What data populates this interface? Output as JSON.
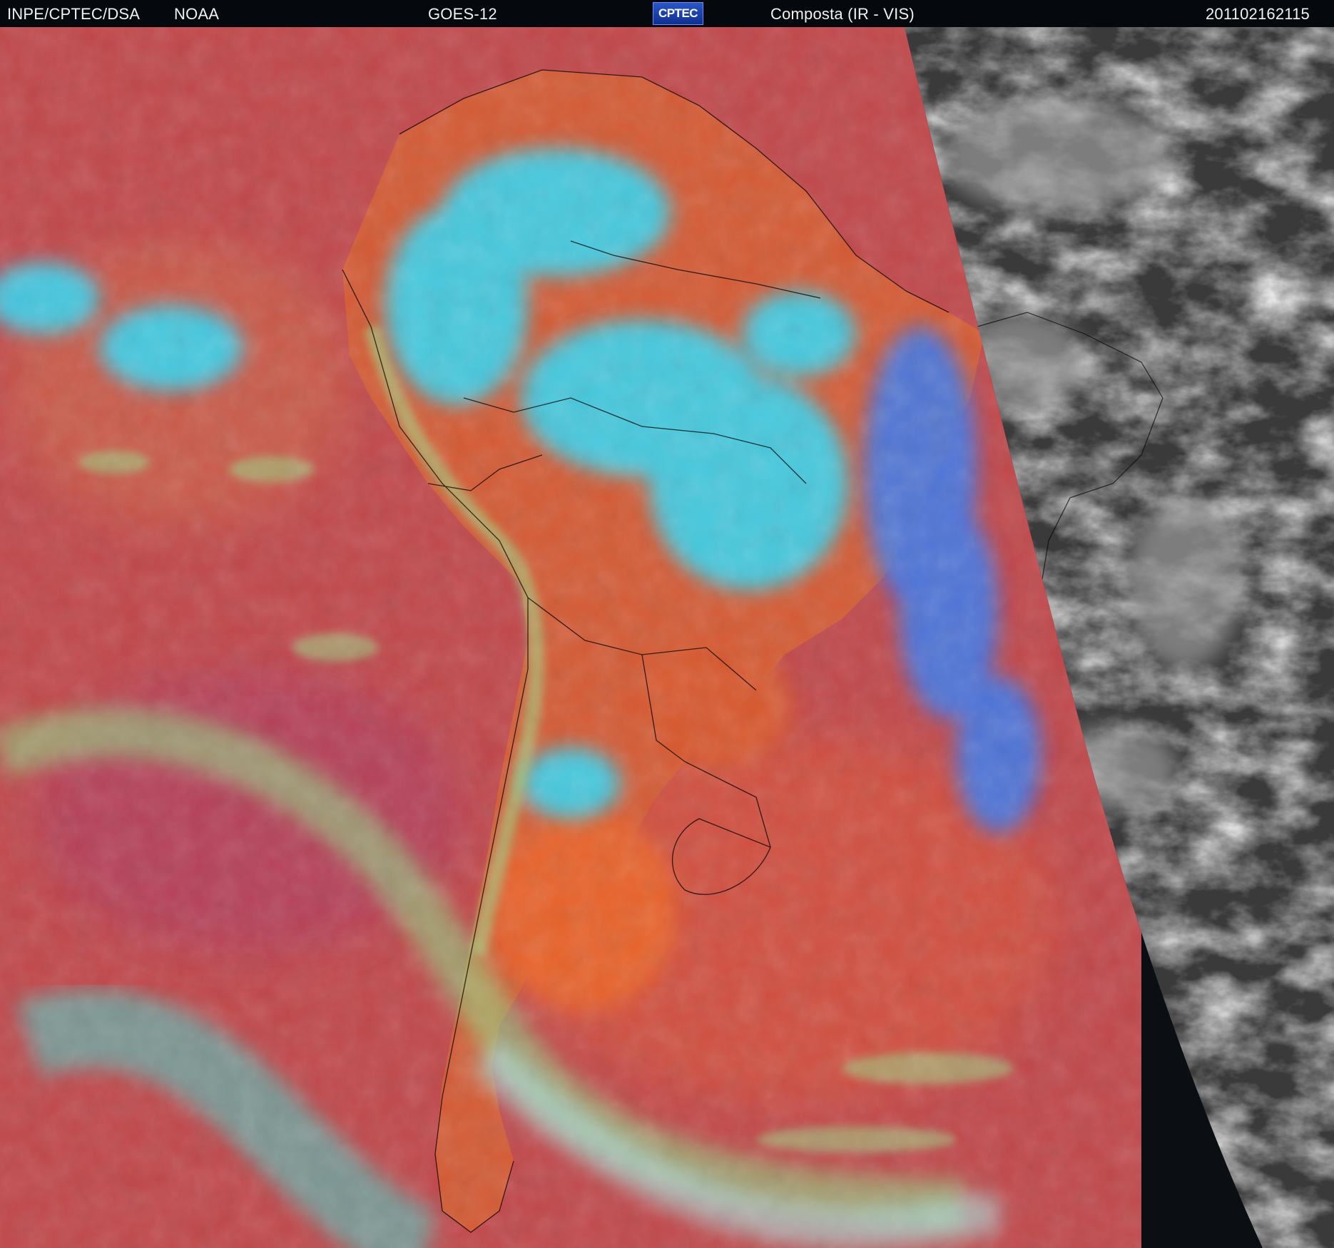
{
  "header": {
    "agency": "INPE/CPTEC/DSA",
    "noaa": "NOAA",
    "satellite": "GOES-12",
    "logo_text": "CPTEC",
    "product": "Composta (IR - VIS)",
    "timestamp": "201102162115"
  },
  "colors": {
    "ocean_warm": "#c0474a",
    "land_warm": "#d8582e",
    "cloud_cold": "#38d4f0",
    "cloud_mid": "#8fe08a",
    "deep_convection": "#3b7cf0",
    "night_side": "#3a3a3a",
    "border_lines": "#000000"
  }
}
